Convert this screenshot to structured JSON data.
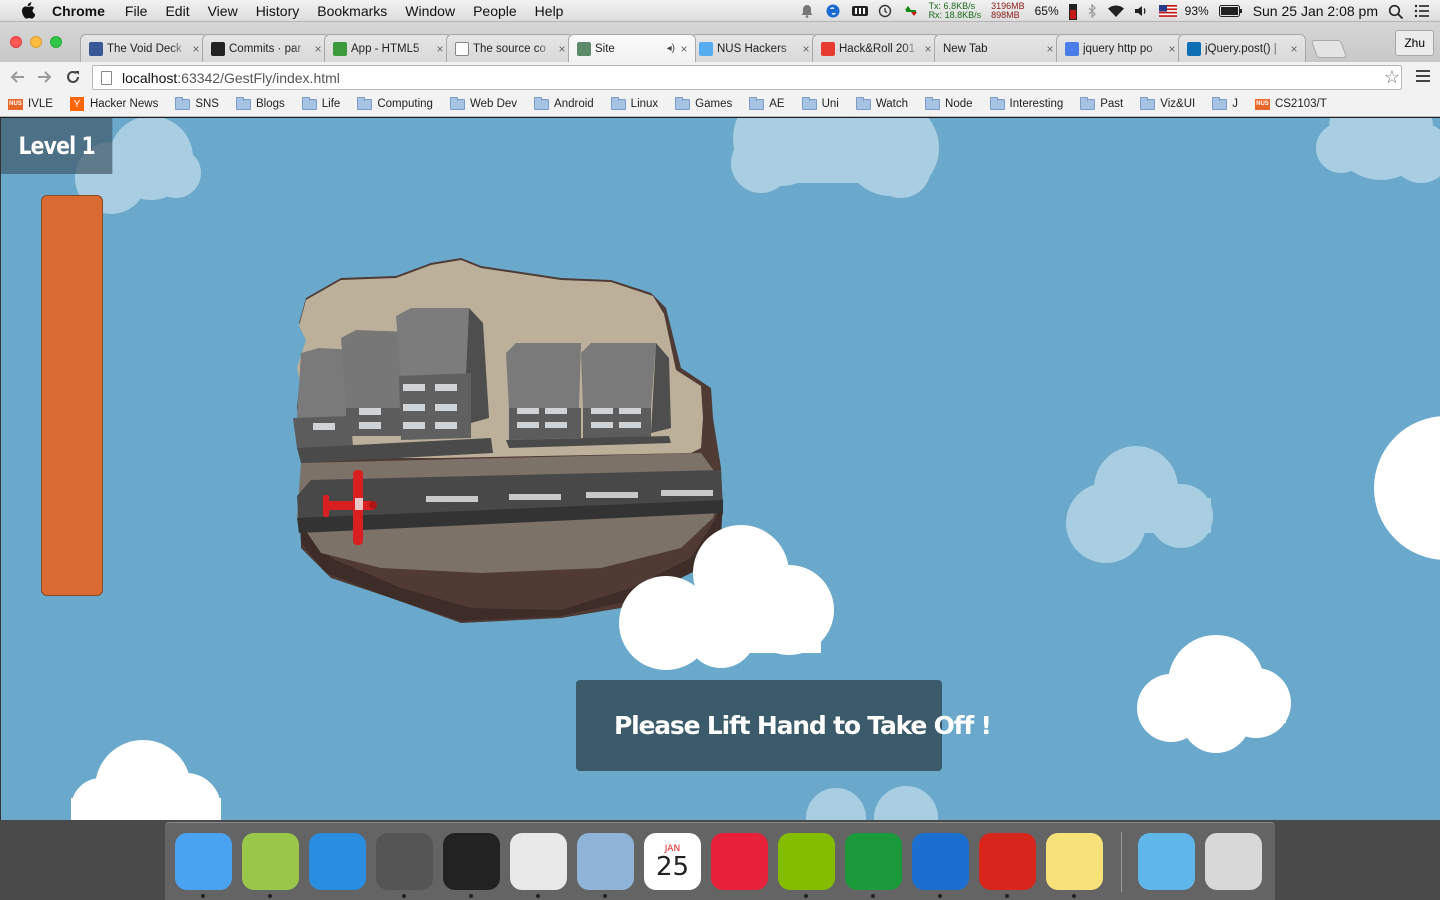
{
  "menubar": {
    "app": "Chrome",
    "items": [
      "File",
      "Edit",
      "View",
      "History",
      "Bookmarks",
      "Window",
      "People",
      "Help"
    ],
    "net_tx": "Tx:   6.8KB/s",
    "net_rx": "Rx:  18.8KB/s",
    "mem_top": "3196MB",
    "mem_bottom": "898MB",
    "cpu_pct": "65%",
    "battery_pct": "93%",
    "clock": "Sun 25 Jan  2:08 pm"
  },
  "tabs": [
    {
      "title": "The Void Deck",
      "icon": "facebook-icon",
      "color": "#3b5998"
    },
    {
      "title": "Commits · par",
      "icon": "github-icon",
      "color": "#222222"
    },
    {
      "title": "App - HTML5",
      "icon": "leaf-icon",
      "color": "#3c9a3c"
    },
    {
      "title": "The source co",
      "icon": "page-icon",
      "color": "#ffffff"
    },
    {
      "title": "Site",
      "icon": "site-icon",
      "color": "#5c8a6a",
      "active": true
    },
    {
      "title": "NUS Hackers",
      "icon": "twitter-icon",
      "color": "#55acee"
    },
    {
      "title": "Hack&Roll 201",
      "icon": "pinwheel-icon",
      "color": "#e63b2e"
    },
    {
      "title": "New Tab",
      "icon": "",
      "color": ""
    },
    {
      "title": "jquery http po",
      "icon": "google-icon",
      "color": "#4a7de8"
    },
    {
      "title": "jQuery.post() |",
      "icon": "jquery-icon",
      "color": "#0f6fb5"
    }
  ],
  "profile_name": "Zhu",
  "omnibox": {
    "host": "localhost",
    "path": ":63342/GestFly/index.html"
  },
  "bookmarks": [
    {
      "label": "IVLE",
      "kind": "nus"
    },
    {
      "label": "Hacker News",
      "kind": "yc"
    },
    {
      "label": "SNS",
      "kind": "folder"
    },
    {
      "label": "Blogs",
      "kind": "folder"
    },
    {
      "label": "Life",
      "kind": "folder"
    },
    {
      "label": "Computing",
      "kind": "folder"
    },
    {
      "label": "Web Dev",
      "kind": "folder"
    },
    {
      "label": "Android",
      "kind": "folder"
    },
    {
      "label": "Linux",
      "kind": "folder"
    },
    {
      "label": "Games",
      "kind": "folder"
    },
    {
      "label": "AE",
      "kind": "folder"
    },
    {
      "label": "Uni",
      "kind": "folder"
    },
    {
      "label": "Watch",
      "kind": "folder"
    },
    {
      "label": "Node",
      "kind": "folder"
    },
    {
      "label": "Interesting",
      "kind": "folder"
    },
    {
      "label": "Past",
      "kind": "folder"
    },
    {
      "label": "Viz&UI",
      "kind": "folder"
    },
    {
      "label": "J",
      "kind": "folder"
    },
    {
      "label": "CS2103/T",
      "kind": "nus"
    }
  ],
  "game": {
    "level_label": "Level 1",
    "fuel_level": 1.0,
    "prompt": "Please Lift Hand to Take Off !",
    "prompt_icon": "pointing-hand-icon",
    "colors": {
      "sky": "#6aa9cb",
      "fuel": "#d96a31",
      "prompt_bg": "#3b5a6a",
      "plane": "#d91f1f"
    }
  },
  "dock": {
    "apps": [
      {
        "name": "finder-icon",
        "color": "#4aa3f0"
      },
      {
        "name": "android-studio-icon",
        "color": "#9ac74a"
      },
      {
        "name": "jetbrains-icon",
        "color": "#2a8ee0"
      },
      {
        "name": "sublime-text-icon",
        "color": "#555555"
      },
      {
        "name": "terminal-icon",
        "color": "#222222"
      },
      {
        "name": "chrome-icon",
        "color": "#e8e8e8"
      },
      {
        "name": "preview-icon",
        "color": "#8fb4d8"
      },
      {
        "name": "calendar-icon",
        "color": "#ffffff"
      },
      {
        "name": "itunes-icon",
        "color": "#e8213a"
      },
      {
        "name": "spotify-icon",
        "color": "#84bd00"
      },
      {
        "name": "excel-icon",
        "color": "#1a9a3a"
      },
      {
        "name": "word-icon",
        "color": "#1b6fd0"
      },
      {
        "name": "powerpoint-icon",
        "color": "#d9261c"
      },
      {
        "name": "notes-icon",
        "color": "#f7e27a"
      }
    ],
    "calendar_month": "JAN",
    "calendar_day": "25",
    "right": [
      {
        "name": "downloads-icon",
        "color": "#5fb6e8"
      },
      {
        "name": "trash-icon",
        "color": "#d8d8d8"
      }
    ]
  }
}
